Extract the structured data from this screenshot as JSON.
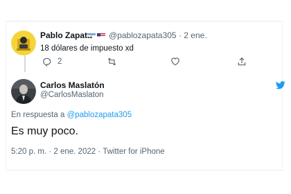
{
  "tweet1": {
    "author_name": "Pablo Zapata",
    "flags": [
      "argentina-flag",
      "usa-flag"
    ],
    "handle": "@pablozapata305",
    "separator": "·",
    "date": "2 ene.",
    "text": "18 dólares de impuesto xd",
    "reply_count": "2"
  },
  "tweet2": {
    "author_name": "Carlos Maslatón",
    "handle": "@CarlosMaslaton",
    "reply_prefix": "En respuesta a",
    "reply_to": "@pablozapata305",
    "text": "Es muy poco.",
    "time": "5:20 p. m.",
    "date": "2 ene. 2022",
    "source": "Twitter for iPhone"
  },
  "colors": {
    "accent": "#1d9bf0",
    "secondary_text": "#536471",
    "primary_text": "#0f1419"
  }
}
